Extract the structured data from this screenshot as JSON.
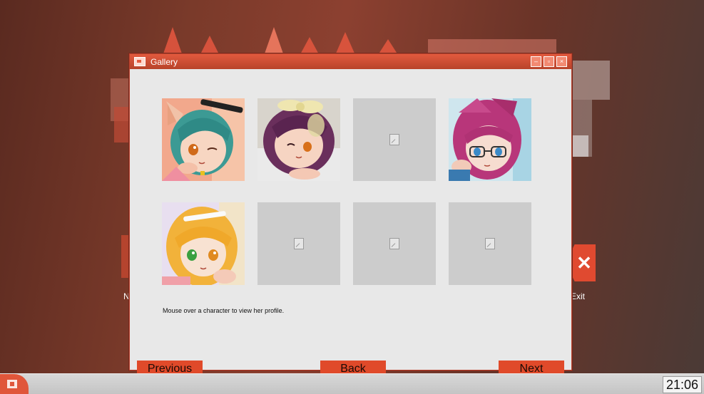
{
  "desktop": {
    "left_icon_label_partial": "N",
    "exit_label": "Exit"
  },
  "window": {
    "title": "Gallery",
    "controls": {
      "minimize": "–",
      "restore": "▫",
      "close": "×"
    }
  },
  "gallery": {
    "items": [
      {
        "state": "unlocked",
        "description": "teal-haired girl with cat ears, winking"
      },
      {
        "state": "unlocked",
        "description": "purple-haired girl with cream bow"
      },
      {
        "state": "locked"
      },
      {
        "state": "unlocked",
        "description": "pink-haired girl with glasses"
      },
      {
        "state": "unlocked",
        "description": "blonde girl with green and orange eyes"
      },
      {
        "state": "locked"
      },
      {
        "state": "locked"
      },
      {
        "state": "locked"
      }
    ],
    "hint": "Mouse over a character to view her profile."
  },
  "buttons": {
    "previous": "Previous",
    "back": "Back",
    "next": "Next"
  },
  "colors": {
    "accent": "#e04a2a",
    "titlebar": "#c9472e",
    "window_bg": "#e8e8e8",
    "placeholder": "#cccccc"
  },
  "taskbar": {
    "clock": "21:06"
  }
}
